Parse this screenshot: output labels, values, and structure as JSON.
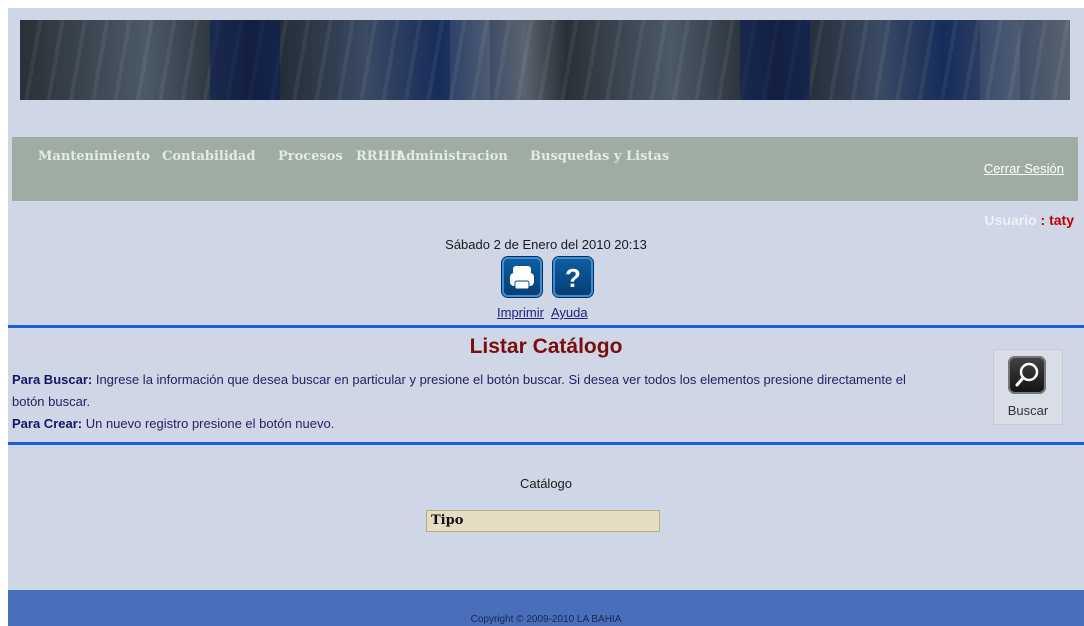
{
  "menu": {
    "items": [
      "Mantenimiento",
      "Contabilidad",
      "Procesos",
      "RRHH",
      "Administracion",
      "Busquedas y Listas"
    ],
    "logout_label": "Cerrar Sesión"
  },
  "user": {
    "label": "Usuario",
    "separator": " : ",
    "name": "taty"
  },
  "datetime": "Sábado 2 de Enero del 2010 20:13",
  "toolbar": {
    "print_label": "Imprimir",
    "help_label": "Ayuda",
    "print_icon": "printer-icon",
    "help_icon": "help-icon"
  },
  "list": {
    "title": "Listar Catálogo",
    "search_prefix": "Para Buscar:",
    "search_text": " Ingrese la información que desea buscar en particular y presione el botón buscar. Si desea ver todos los elementos presione directamente el botón buscar.",
    "create_prefix": "Para Crear:",
    "create_text": " Un nuevo registro presione el botón nuevo.",
    "search_button_label": "Buscar",
    "search_icon": "magnifier-icon"
  },
  "catalog": {
    "label": "Catálogo",
    "column": "Tipo"
  },
  "footer": {
    "copyright": "Copyright © 2009-2010 LA BAHIA"
  },
  "colors": {
    "menubar": "#9eaca2",
    "separator": "#1b5fd6",
    "title": "#7a0e0e",
    "footer": "#4a6fba",
    "username": "#c00000"
  }
}
